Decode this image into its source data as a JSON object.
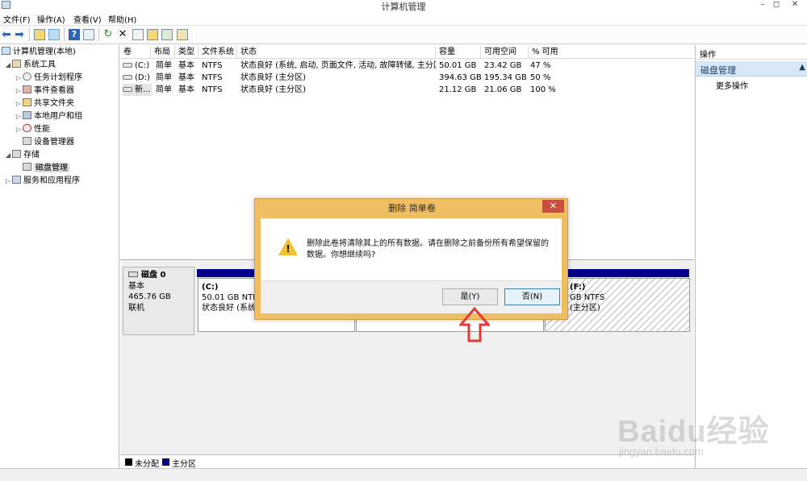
{
  "window": {
    "title": "计算机管理",
    "minimize": "–",
    "restore": "◻",
    "close": "✕"
  },
  "menu": [
    "文件(F)",
    "操作(A)",
    "查看(V)",
    "帮助(H)"
  ],
  "tree": {
    "root": "计算机管理(本地)",
    "system_tools": "系统工具",
    "task_scheduler": "任务计划程序",
    "event_viewer": "事件查看器",
    "shared_folders": "共享文件夹",
    "local_users": "本地用户和组",
    "performance": "性能",
    "device_manager": "设备管理器",
    "storage": "存储",
    "disk_management": "磁盘管理",
    "services_apps": "服务和应用程序"
  },
  "volume_table": {
    "headers": [
      "卷",
      "布局",
      "类型",
      "文件系统",
      "状态",
      "容量",
      "可用空间",
      "% 可用"
    ],
    "rows": [
      [
        "(C:)",
        "简单",
        "基本",
        "NTFS",
        "状态良好 (系统, 启动, 页面文件, 活动, 故障转储, 主分区)",
        "50.01 GB",
        "23.42 GB",
        "47 %"
      ],
      [
        "(D:)",
        "简单",
        "基本",
        "NTFS",
        "状态良好 (主分区)",
        "394.63 GB",
        "195.34 GB",
        "50 %"
      ],
      [
        "新...",
        "简单",
        "基本",
        "NTFS",
        "状态良好 (主分区)",
        "21.12 GB",
        "21.06 GB",
        "100 %"
      ]
    ]
  },
  "disk": {
    "name": "磁盘 0",
    "type": "基本",
    "size": "465.76 GB",
    "status": "联机",
    "partitions": [
      {
        "name": "(C:)",
        "size": "50.01 GB NTFS",
        "status": "状态良好 (系统,",
        "hatched": false
      },
      {
        "name": "",
        "size": "",
        "status": "",
        "hatched": false
      },
      {
        "name": "(F:)",
        "size": "GB NTFS",
        "status": "(主分区)",
        "hatched": true
      }
    ]
  },
  "legend": [
    {
      "label": "未分配",
      "color": "#000000"
    },
    {
      "label": "主分区",
      "color": "#00008b"
    }
  ],
  "actions": {
    "header": "操作",
    "section": "磁盘管理",
    "more": "更多操作"
  },
  "dialog": {
    "title": "删除 简单卷",
    "close": "✕",
    "message": "删除此卷将清除其上的所有数据。请在删除之前备份所有希望保留的数据。你想继续吗?",
    "yes": "是(Y)",
    "no": "否(N)"
  },
  "watermark": {
    "logo": "Baidu经验",
    "url": "jingyan.baidu.com"
  },
  "colors": {
    "dialog_frame": "#f0be62",
    "partition_bar": "#00008b",
    "annotation": "#e53935",
    "actions_section": "#d7e7f6"
  },
  "icons": [
    "back-arrow-icon",
    "forward-arrow-icon",
    "folder-up-icon",
    "console-tree-icon",
    "help-icon",
    "properties-icon",
    "refresh-icon",
    "delete-icon",
    "properties-sheet-icon",
    "open-folder-icon",
    "search-disk-icon",
    "export-icon",
    "warning-icon"
  ]
}
